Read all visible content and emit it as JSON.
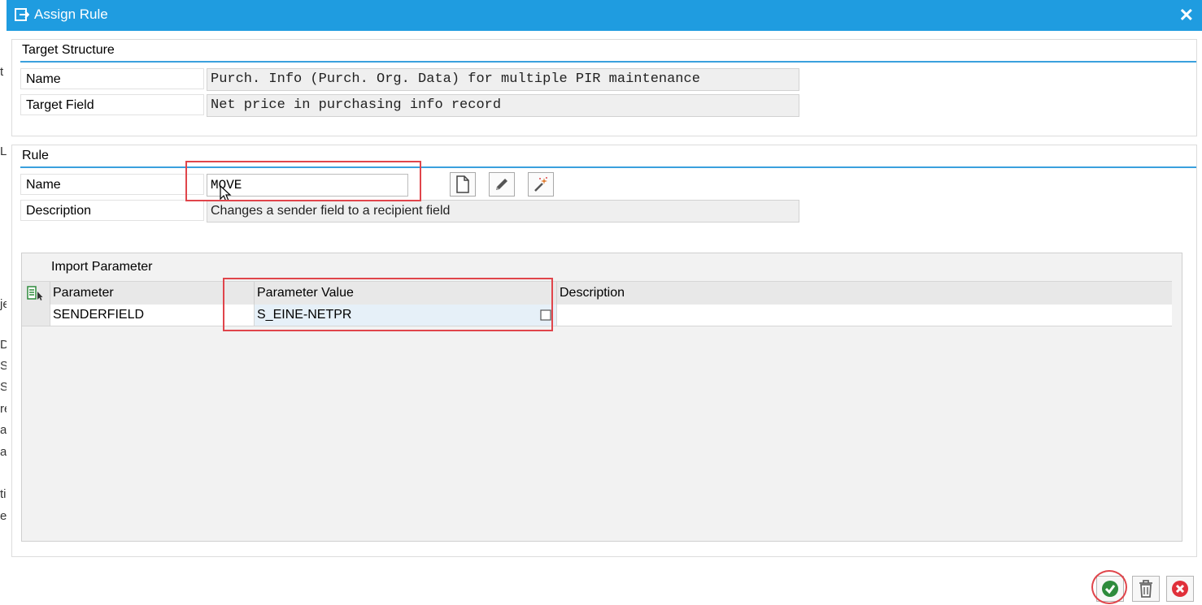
{
  "window": {
    "title": "Assign Rule",
    "close_glyph": "✕"
  },
  "background_letters": [
    "t",
    "L",
    "je",
    "D",
    "S",
    "S",
    "re",
    "a",
    "a",
    "ti",
    "es"
  ],
  "target_structure": {
    "heading": "Target Structure",
    "name_label": "Name",
    "name_value": "Purch. Info (Purch. Org. Data) for multiple PIR maintenance",
    "field_label": "Target Field",
    "field_value": "Net price in purchasing info record"
  },
  "rule": {
    "heading": "Rule",
    "name_label": "Name",
    "name_value": "MOVE",
    "description_label": "Description",
    "description_value": "Changes a sender field to a recipient field",
    "buttons": [
      {
        "icon": "new-document-icon"
      },
      {
        "icon": "pencil-edit-icon"
      },
      {
        "icon": "magic-wand-icon"
      }
    ]
  },
  "import_parameter": {
    "title": "Import Parameter",
    "columns": [
      "Parameter",
      "Parameter Value",
      "Description"
    ],
    "rows": [
      {
        "parameter": "SENDERFIELD",
        "value": "S_EINE-NETPR",
        "description": ""
      }
    ]
  },
  "footer": {
    "buttons": [
      {
        "icon": "confirm-check-icon",
        "color": "#2e8b3c"
      },
      {
        "icon": "trash-delete-icon",
        "color": "#666666"
      },
      {
        "icon": "cancel-x-icon",
        "color": "#e0303a"
      }
    ]
  },
  "colors": {
    "title_bar": "#1f9ce0",
    "highlight": "#e0454b",
    "heading_rule": "#3aa0dd"
  }
}
